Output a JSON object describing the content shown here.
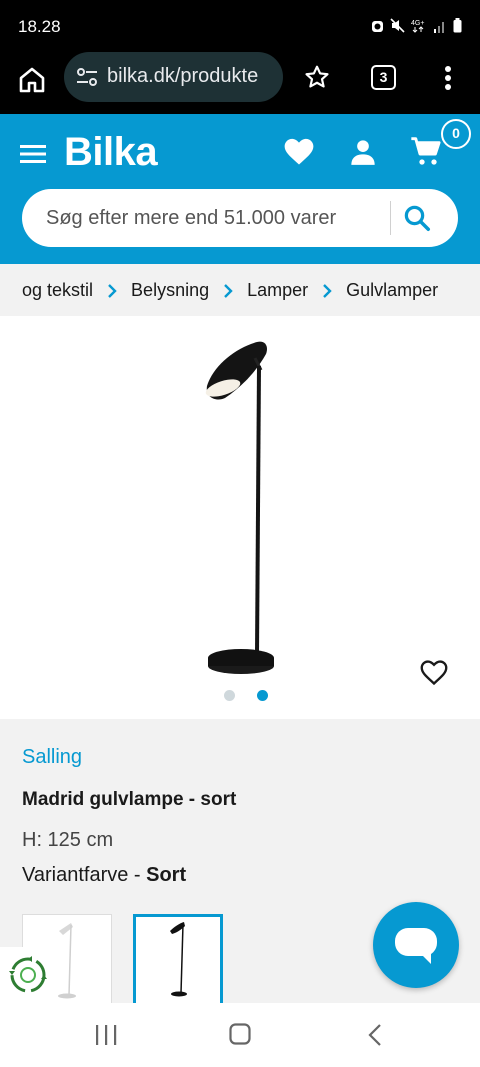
{
  "status": {
    "time": "18.28"
  },
  "browser": {
    "url": "bilka.dk/produkte",
    "tab_count": "3"
  },
  "header": {
    "logo": "Bilka",
    "cart_count": "0",
    "search_placeholder": "Søg efter mere end 51.000 varer"
  },
  "breadcrumb": [
    "og tekstil",
    "Belysning",
    "Lamper",
    "Gulvlamper"
  ],
  "gallery": {
    "image_count": 2,
    "active_index": 1
  },
  "product": {
    "brand": "Salling",
    "title": "Madrid gulvlampe - sort",
    "height": "H: 125 cm",
    "variant_label": "Variantfarve - ",
    "variant_value": "Sort"
  },
  "colors": {
    "brand_blue": "#0699d1",
    "light_gray": "#f2f2f2"
  }
}
